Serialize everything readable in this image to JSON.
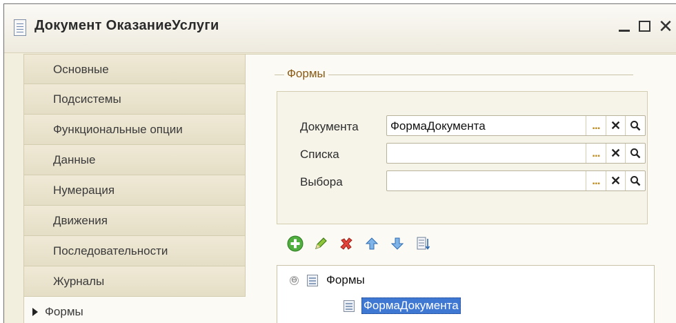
{
  "window": {
    "title": "Документ ОказаниеУслуги",
    "icon": "document-icon",
    "controls": [
      "_",
      "☐",
      "✕"
    ]
  },
  "sidebar": {
    "items": [
      {
        "label": "Основные"
      },
      {
        "label": "Подсистемы"
      },
      {
        "label": "Функциональные опции"
      },
      {
        "label": "Данные"
      },
      {
        "label": "Нумерация"
      },
      {
        "label": "Движения"
      },
      {
        "label": "Последовательности"
      },
      {
        "label": "Журналы"
      },
      {
        "label": "Формы",
        "active": true
      }
    ]
  },
  "forms_group": {
    "title": "Формы",
    "fields": [
      {
        "label": "Документа",
        "value": "ФормаДокумента",
        "buttons": [
          "...",
          "✕",
          "search"
        ]
      },
      {
        "label": "Списка",
        "value": "",
        "buttons": [
          "...",
          "✕",
          "search"
        ]
      },
      {
        "label": "Выбора",
        "value": "",
        "buttons": [
          "...",
          "✕",
          "search"
        ]
      }
    ],
    "buttons": {
      "dots": "...",
      "clear": "✕"
    }
  },
  "toolbar": {
    "icons": [
      "add-icon",
      "edit-icon",
      "delete-icon",
      "move-up-icon",
      "move-down-icon",
      "sort-list-icon"
    ]
  },
  "tree": {
    "root": {
      "label": "Формы",
      "expanded": true,
      "toggle": "⊖"
    },
    "children": [
      {
        "label": "ФормаДокумента",
        "selected": true
      }
    ]
  },
  "colors": {
    "background": "#f3efdf",
    "group_title": "#8a5a14",
    "selection": "#3f78d3",
    "dots_button": "#c08a1e"
  }
}
